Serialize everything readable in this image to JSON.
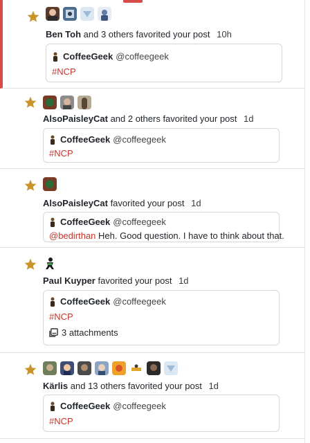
{
  "colors": {
    "accent": "#d94c4c",
    "star": "#c9952b",
    "hashtag": "#c7352a",
    "border": "#d7d7d7"
  },
  "notifications": [
    {
      "actor": "Ben Toh",
      "rest": "and 3 others favorited your post",
      "time": "10h",
      "post": {
        "author": "CoffeeGeek",
        "handle": "@coffeegeek",
        "text": "#NCP"
      }
    },
    {
      "actor": "AlsoPaisleyCat",
      "rest": "and 2 others favorited your post",
      "time": "1d",
      "post": {
        "author": "CoffeeGeek",
        "handle": "@coffeegeek",
        "text": "#NCP"
      }
    },
    {
      "actor": "AlsoPaisleyCat",
      "rest": "favorited your post",
      "time": "1d",
      "post": {
        "author": "CoffeeGeek",
        "handle": "@coffeegeek",
        "mention": "@bedirthan",
        "text": "Heh. Good question. I have to think about that."
      }
    },
    {
      "actor": "Paul Kuyper",
      "rest": "favorited your post",
      "time": "1d",
      "post": {
        "author": "CoffeeGeek",
        "handle": "@coffeegeek",
        "text": "#NCP",
        "attachments": "3 attachments"
      }
    },
    {
      "actor": "Kärlis",
      "rest": "and 13 others favorited your post",
      "time": "1d",
      "post": {
        "author": "CoffeeGeek",
        "handle": "@coffeegeek",
        "text": "#NCP"
      }
    }
  ],
  "icons": {
    "star": "star-icon",
    "attachments": "gallery-icon"
  }
}
